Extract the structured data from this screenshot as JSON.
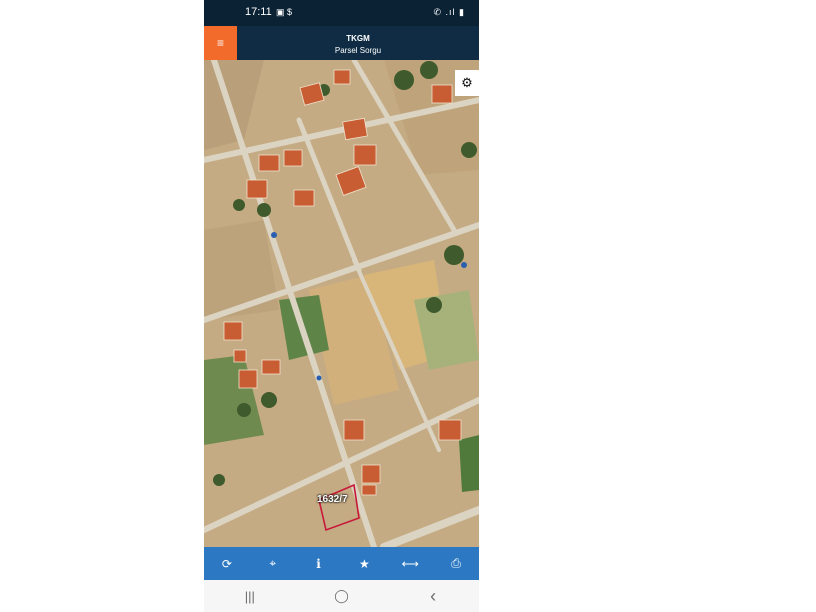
{
  "status_bar": {
    "time": "17:11",
    "left_icons": "▣ $",
    "right_icons": "✆ .ıl ▮"
  },
  "app_bar": {
    "menu_icon": "≡",
    "title": "TKGM",
    "subtitle": "Parsel Sorgu"
  },
  "map": {
    "settings_icon": "⚙",
    "parcel_label": "1632/7",
    "parcel_outline_color": "#c8183a"
  },
  "toolbar": {
    "buttons": [
      {
        "name": "refresh-icon",
        "glyph": "⟳"
      },
      {
        "name": "locate-icon",
        "glyph": "⌖"
      },
      {
        "name": "info-icon",
        "glyph": "i"
      },
      {
        "name": "star-icon",
        "glyph": "★"
      },
      {
        "name": "measure-icon",
        "glyph": "⟷"
      },
      {
        "name": "print-icon",
        "glyph": "⎙"
      }
    ]
  },
  "nav_bar": {
    "recents": "|||",
    "home": "◯",
    "back": "‹"
  },
  "colors": {
    "status_bar": "#0b2235",
    "app_bar": "#0f2c44",
    "menu_button": "#f26b2a",
    "toolbar": "#2d78c2"
  }
}
